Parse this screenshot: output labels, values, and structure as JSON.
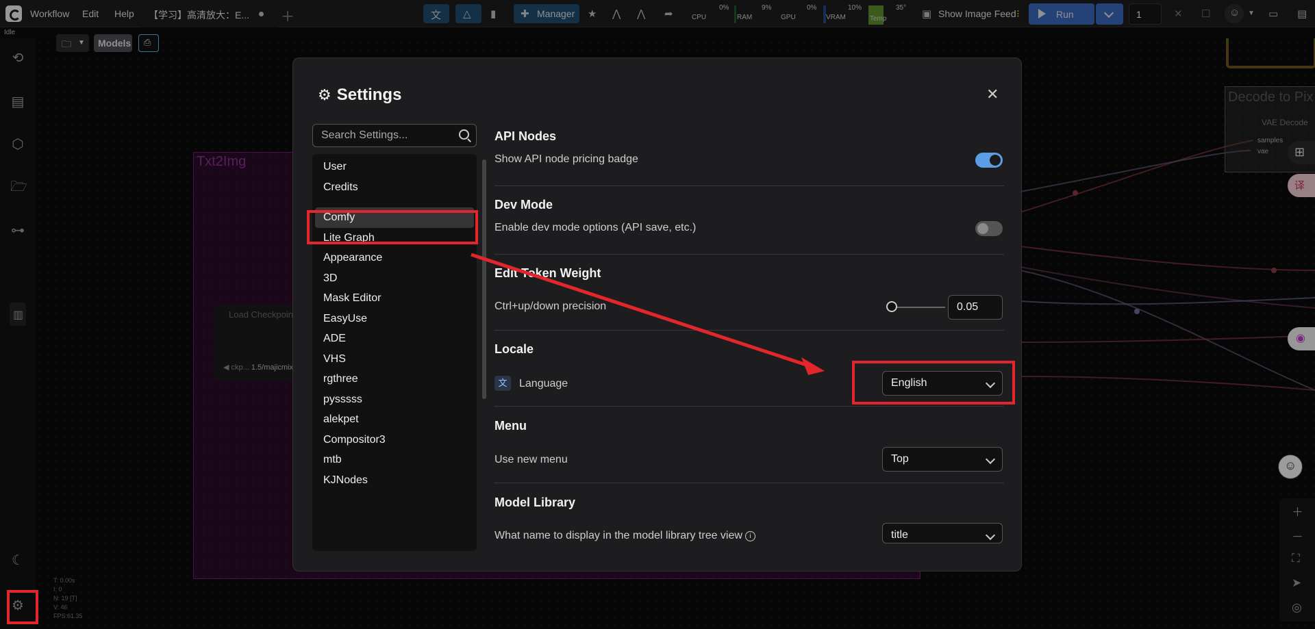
{
  "topbar": {
    "menu": [
      "Workflow",
      "Edit",
      "Help"
    ],
    "tab_title": "【学习】高清放大：E...",
    "manager_label": "Manager",
    "stats": [
      {
        "name": "CPU",
        "value": "0%"
      },
      {
        "name": "RAM",
        "value": "9%"
      },
      {
        "name": "GPU",
        "value": "0%"
      },
      {
        "name": "VRAM",
        "value": "10%"
      },
      {
        "name": "Temp",
        "value": "35°"
      }
    ],
    "image_feed_label": "Show Image Feed",
    "run_label": "Run",
    "queue_count": "1"
  },
  "status": "Idle",
  "toolbar": {
    "models_label": "Models"
  },
  "canvas": {
    "group_title": "Txt2Img",
    "load_node_title": "Load Checkpoint",
    "load_node_widget_prefix": "◀ ckp...",
    "load_node_widget_value": "1.5/majicmix",
    "decode_group_title": "Decode to Pix",
    "decode_node_title": "VAE Decode",
    "decode_inputs": [
      "samples",
      "vae"
    ],
    "debug_lines": [
      "T: 0.00s",
      "I: 0",
      "N: 19 [T]",
      "V: 46",
      "FPS:61.35"
    ]
  },
  "dialog": {
    "title": "Settings",
    "search_placeholder": "Search Settings...",
    "categories": [
      "User",
      "Credits",
      "Comfy",
      "Lite Graph",
      "Appearance",
      "3D",
      "Mask Editor",
      "EasyUse",
      "ADE",
      "VHS",
      "rgthree",
      "pysssss",
      "alekpet",
      "Compositor3",
      "mtb",
      "KJNodes"
    ],
    "selected_category": "Comfy",
    "sections": {
      "api_nodes": {
        "title": "API Nodes",
        "label": "Show API node pricing badge",
        "enabled": true
      },
      "dev_mode": {
        "title": "Dev Mode",
        "label": "Enable dev mode options (API save, etc.)",
        "enabled": false
      },
      "token_weight": {
        "title": "Edit Token Weight",
        "label": "Ctrl+up/down precision",
        "value": "0.05"
      },
      "locale": {
        "title": "Locale",
        "label": "Language",
        "value": "English"
      },
      "menu": {
        "title": "Menu",
        "label": "Use new menu",
        "value": "Top"
      },
      "model_library": {
        "title": "Model Library",
        "label": "What name to display in the model library tree view",
        "value": "title"
      }
    }
  },
  "colors": {
    "accent": "#5c9ee6",
    "highlight": "#e2262b",
    "run": "#3a66b8"
  }
}
